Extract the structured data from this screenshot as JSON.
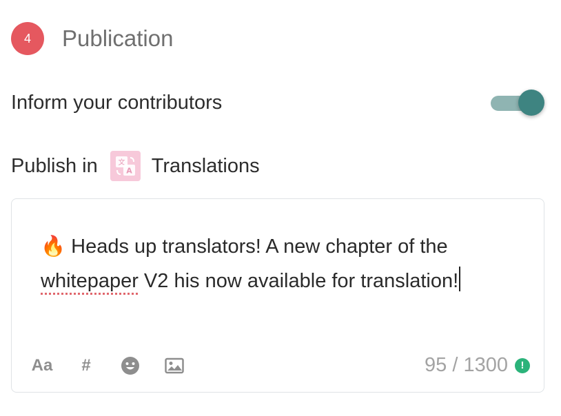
{
  "step": {
    "number": "4",
    "title": "Publication"
  },
  "inform": {
    "label": "Inform your contributors",
    "enabled": true
  },
  "publish": {
    "label": "Publish in",
    "channel_name": "Translations",
    "channel_icon": "translate-icon"
  },
  "message": {
    "emoji": "🔥",
    "before": " Heads up translators! A new chapter of the ",
    "misspelled": "whitepaper",
    "after": " V2 his now available  for translation!"
  },
  "toolbar": {
    "format_label": "Aa",
    "hashtag_label": "#",
    "icons": [
      "format-text-icon",
      "hashtag-icon",
      "emoji-icon",
      "image-icon"
    ]
  },
  "counter": {
    "text": "95 / 1300",
    "icon": "exclamation-icon"
  },
  "colors": {
    "badge": "#e5585f",
    "toggle": "#3e8481",
    "counter_ok": "#2bb37a"
  }
}
